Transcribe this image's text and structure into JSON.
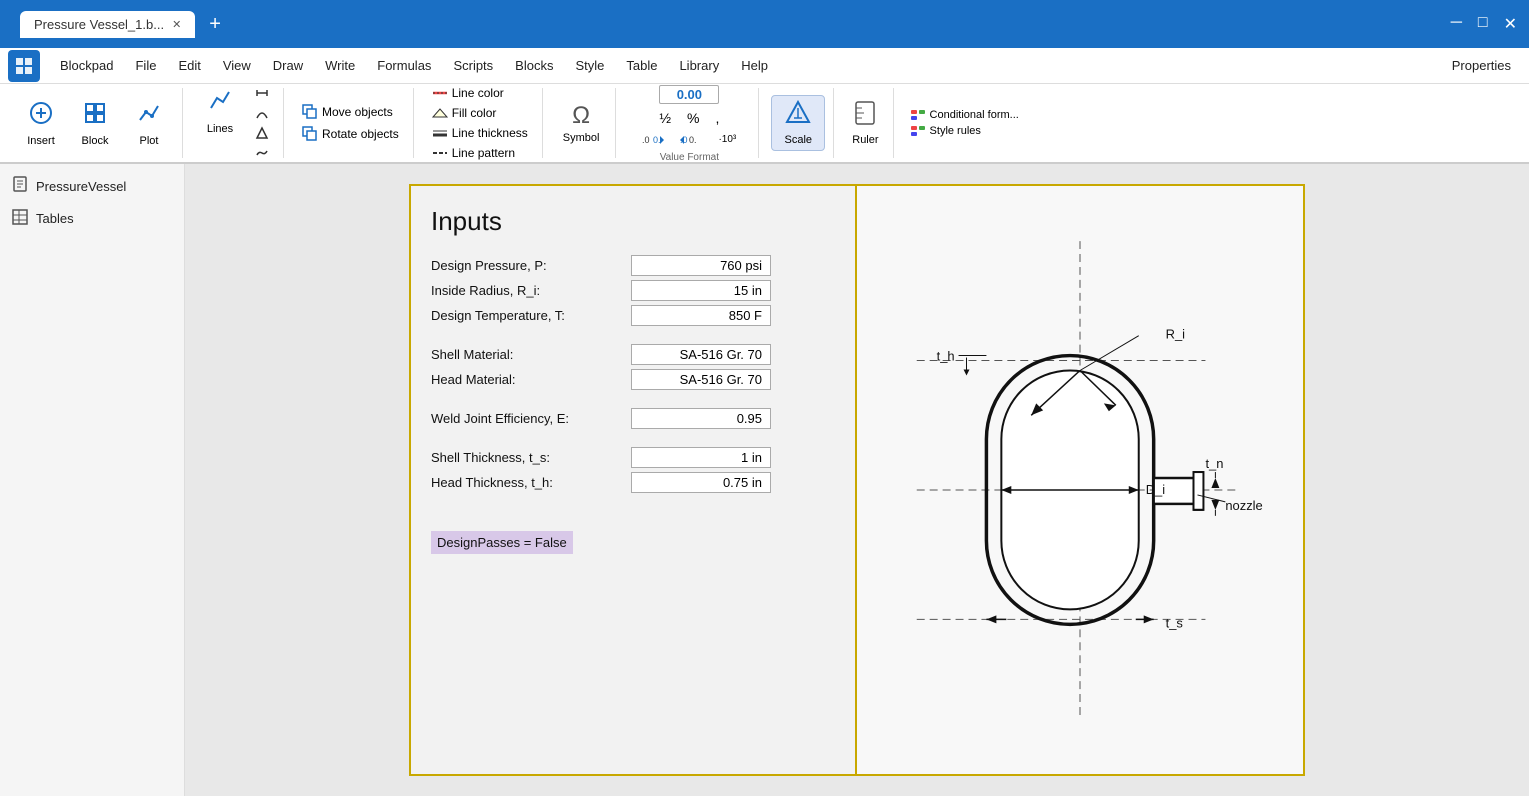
{
  "titlebar": {
    "tab_label": "Pressure Vessel_1.b...",
    "close_icon": "✕",
    "add_tab_icon": "+",
    "minimize_icon": "─",
    "maximize_icon": "□",
    "window_close_icon": "✕"
  },
  "menubar": {
    "logo_text": "≡",
    "items": [
      "Blockpad",
      "File",
      "Edit",
      "View",
      "Draw",
      "Write",
      "Formulas",
      "Scripts",
      "Blocks",
      "Style",
      "Table",
      "Library",
      "Help"
    ],
    "properties_label": "Properties"
  },
  "ribbon": {
    "insert_label": "Insert",
    "block_label": "Block",
    "plot_label": "Plot",
    "lines_label": "Lines",
    "move_objects_label": "Move objects",
    "rotate_objects_label": "Rotate objects",
    "line_color_label": "Line color",
    "line_thickness_label": "Line thickness",
    "fill_color_label": "Fill color",
    "line_pattern_label": "Line pattern",
    "symbol_label": "Symbol",
    "value_format_label": "Value Format",
    "value_format_value": "0.00",
    "scale_label": "Scale",
    "ruler_label": "Ruler",
    "conditional_form_label": "Conditional form...",
    "style_rules_label": "Style rules"
  },
  "sidebar": {
    "items": [
      {
        "id": "pressure-vessel",
        "icon": "📄",
        "label": "PressureVessel"
      },
      {
        "id": "tables",
        "icon": "⊞",
        "label": "Tables"
      }
    ]
  },
  "document": {
    "left_panel": {
      "title": "Inputs",
      "fields": [
        {
          "label": "Design Pressure, P:",
          "value": "760 psi"
        },
        {
          "label": "Inside Radius, R_i:",
          "value": "15 in"
        },
        {
          "label": "Design Temperature, T:",
          "value": "850 F"
        },
        {
          "label": "Shell Material:",
          "value": "SA-516 Gr. 70"
        },
        {
          "label": "Head Material:",
          "value": "SA-516 Gr. 70"
        },
        {
          "label": "Weld Joint Efficiency, E:",
          "value": "0.95"
        },
        {
          "label": "Shell Thickness, t_s:",
          "value": "1 in"
        },
        {
          "label": "Head Thickness, t_h:",
          "value": "0.75 in"
        }
      ],
      "result_text": "DesignPasses = False"
    },
    "right_panel": {
      "labels": {
        "t_h": "t_h",
        "R_i": "R_i",
        "D_i": "D_i",
        "t_n": "t_n",
        "nozzle": "nozzle",
        "t_s": "t_s"
      }
    }
  }
}
